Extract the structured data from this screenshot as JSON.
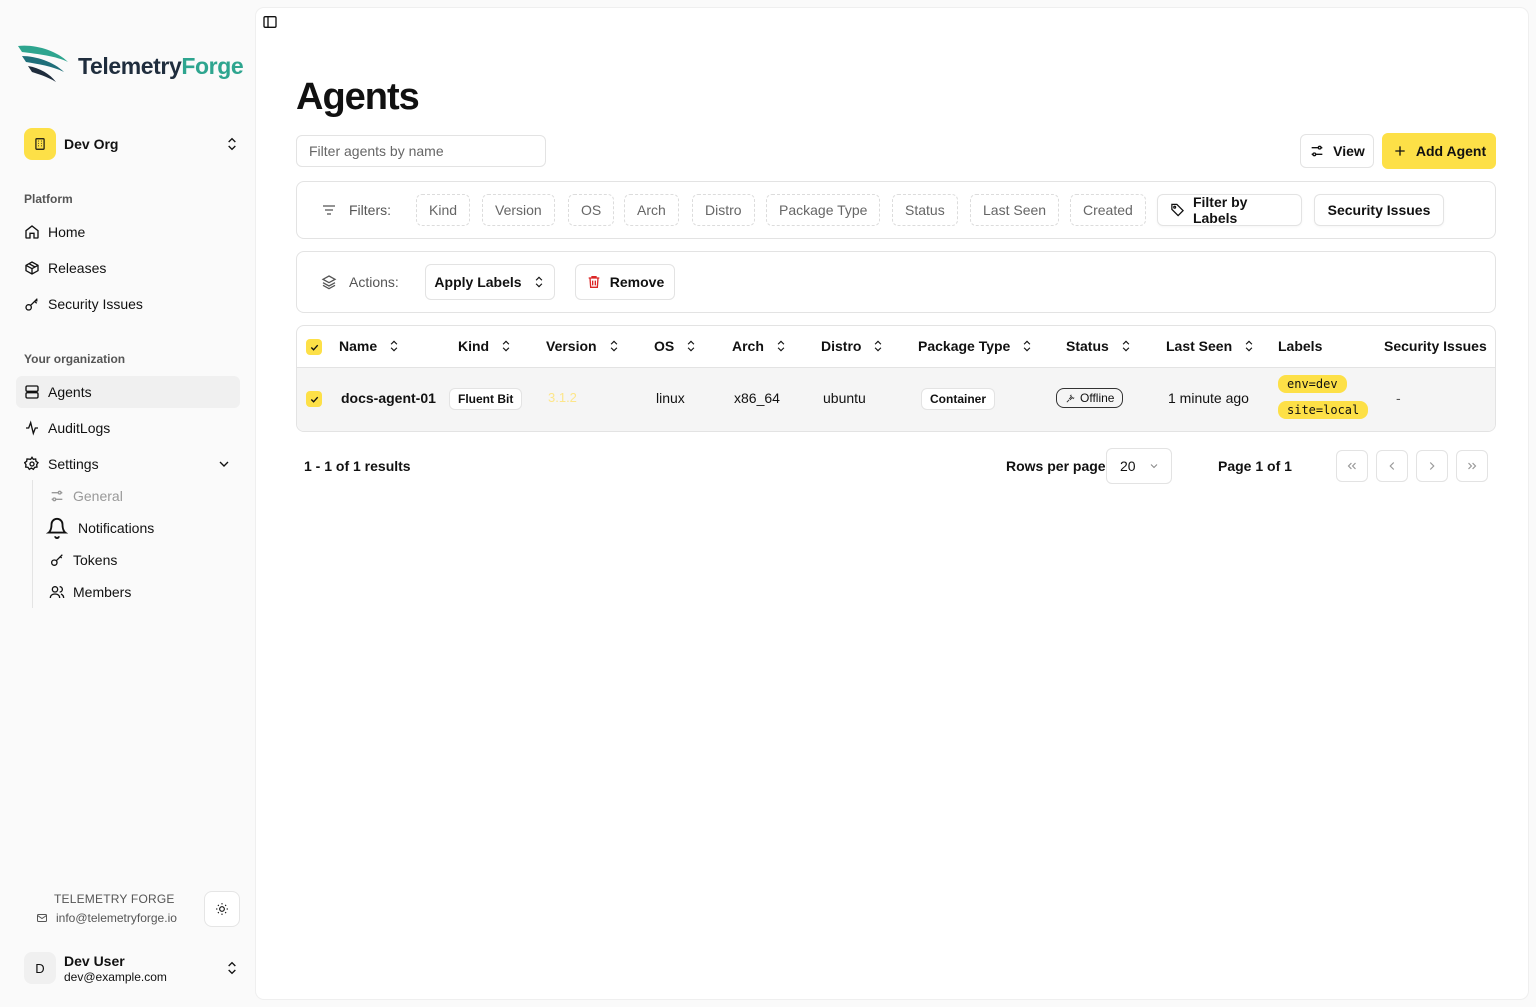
{
  "brand": {
    "part1": "Telemetry",
    "part2": "Forge"
  },
  "org": {
    "name": "Dev Org"
  },
  "sidebar": {
    "platform_label": "Platform",
    "platform_items": [
      {
        "label": "Home",
        "icon": "home-icon"
      },
      {
        "label": "Releases",
        "icon": "package-icon"
      },
      {
        "label": "Security Issues",
        "icon": "key-icon"
      }
    ],
    "org_label": "Your organization",
    "org_items": [
      {
        "label": "Agents",
        "icon": "server-icon",
        "active": true
      },
      {
        "label": "AuditLogs",
        "icon": "activity-icon"
      },
      {
        "label": "Settings",
        "icon": "gear-icon",
        "expanded": true
      }
    ],
    "settings_items": [
      {
        "label": "General",
        "icon": "sliders-icon",
        "muted": true
      },
      {
        "label": "Notifications",
        "icon": "bell-icon"
      },
      {
        "label": "Tokens",
        "icon": "key-icon"
      },
      {
        "label": "Members",
        "icon": "users-icon"
      }
    ]
  },
  "footer": {
    "brand": "TELEMETRY FORGE",
    "email": "info@telemetryforge.io"
  },
  "user": {
    "initial": "D",
    "name": "Dev User",
    "email": "dev@example.com"
  },
  "main": {
    "title": "Agents",
    "filter_placeholder": "Filter agents by name",
    "view_label": "View",
    "add_label": "Add Agent",
    "filters_label": "Filters:",
    "filter_chips": [
      "Kind",
      "Version",
      "OS",
      "Arch",
      "Distro",
      "Package Type",
      "Status",
      "Last Seen",
      "Created"
    ],
    "filter_by_labels": "Filter by Labels",
    "security_issues_btn": "Security Issues",
    "actions_label": "Actions:",
    "apply_labels": "Apply Labels",
    "remove": "Remove"
  },
  "table": {
    "columns": [
      "Name",
      "Kind",
      "Version",
      "OS",
      "Arch",
      "Distro",
      "Package Type",
      "Status",
      "Last Seen",
      "Labels",
      "Security Issues"
    ],
    "rows": [
      {
        "name": "docs-agent-01",
        "kind": "Fluent Bit",
        "version": "3.1.2",
        "os": "linux",
        "arch": "x86_64",
        "distro": "ubuntu",
        "package_type": "Container",
        "status": "Offline",
        "last_seen": "1 minute ago",
        "labels": [
          "env=dev",
          "site=local"
        ],
        "security_issues": "-",
        "selected": true
      }
    ]
  },
  "pagination": {
    "results": "1 - 1 of 1 results",
    "rows_per_page_label": "Rows per page",
    "rows_per_page": "20",
    "page_info": "Page 1 of 1"
  },
  "colors": {
    "accent": "#fde047",
    "brand_green": "#2ea58f",
    "brand_navy": "#1f2d3d"
  }
}
